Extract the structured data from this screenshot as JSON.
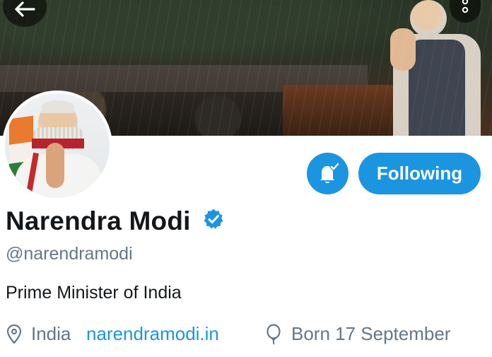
{
  "profile": {
    "name": "Narendra Modi",
    "handle": "@narendramodi",
    "bio": "Prime Minister of India",
    "location": "India",
    "website": "narendramodi.in",
    "birthday": "Born 17 September"
  },
  "actions": {
    "follow_label": "Following",
    "notification_icon": "bell-check-icon"
  },
  "colors": {
    "accent": "#1b95e0",
    "name_text": "#14171a",
    "secondary_text": "#657786"
  },
  "icons": {
    "back": "arrow-left-icon",
    "more": "more-vertical-icon",
    "verified": "verified-badge-icon",
    "location": "map-pin-icon",
    "birthday": "balloon-icon"
  }
}
